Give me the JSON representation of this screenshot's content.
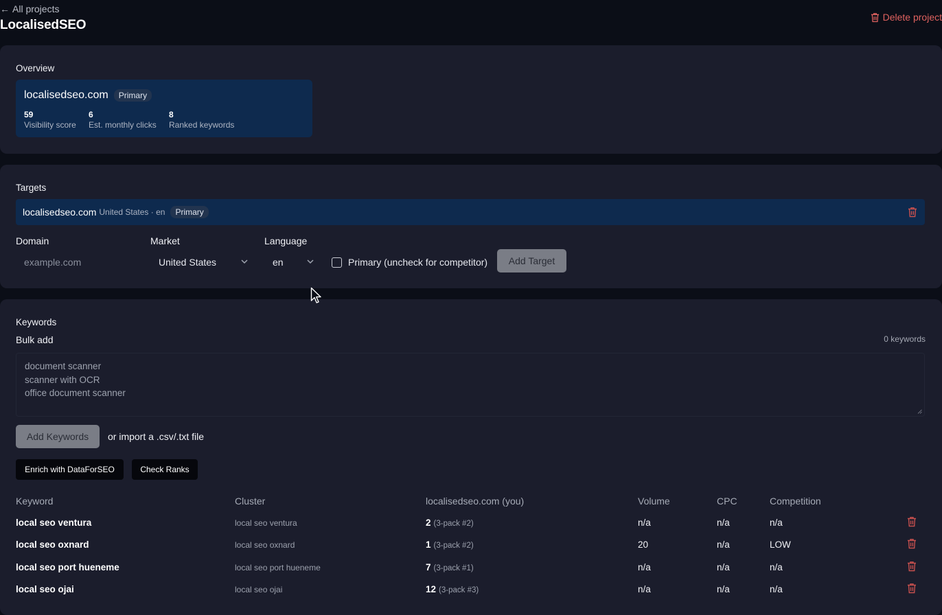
{
  "header": {
    "back_label": "All projects",
    "project_name": "LocalisedSEO",
    "delete_label": "Delete project"
  },
  "overview": {
    "heading": "Overview",
    "domain": "localisedseo.com",
    "badge": "Primary",
    "stats": [
      {
        "value": "59",
        "label": "Visibility score"
      },
      {
        "value": "6",
        "label": "Est. monthly clicks"
      },
      {
        "value": "8",
        "label": "Ranked keywords"
      }
    ]
  },
  "targets": {
    "heading": "Targets",
    "row": {
      "domain": "localisedseo.com",
      "meta": "United States · en",
      "badge": "Primary"
    },
    "form": {
      "domain_label": "Domain",
      "domain_placeholder": "example.com",
      "market_label": "Market",
      "market_value": "United States",
      "language_label": "Language",
      "language_value": "en",
      "primary_label": "Primary (uncheck for competitor)",
      "add_button": "Add Target"
    }
  },
  "keywords": {
    "heading": "Keywords",
    "bulk_label": "Bulk add",
    "count": "0 keywords",
    "placeholder_lines": [
      "document scanner",
      "scanner with OCR",
      "office document scanner"
    ],
    "add_button": "Add Keywords",
    "import_text": "or import a .csv/.txt file",
    "enrich_button": "Enrich with DataForSEO",
    "check_button": "Check Ranks",
    "columns": [
      "Keyword",
      "Cluster",
      "localisedseo.com (you)",
      "Volume",
      "CPC",
      "Competition"
    ],
    "rows": [
      {
        "keyword": "local seo ventura",
        "cluster": "local seo ventura",
        "rank": "2",
        "pack": "(3-pack #2)",
        "volume": "n/a",
        "cpc": "n/a",
        "competition": "n/a"
      },
      {
        "keyword": "local seo oxnard",
        "cluster": "local seo oxnard",
        "rank": "1",
        "pack": "(3-pack #2)",
        "volume": "20",
        "cpc": "n/a",
        "competition": "LOW"
      },
      {
        "keyword": "local seo port hueneme",
        "cluster": "local seo port hueneme",
        "rank": "7",
        "pack": "(3-pack #1)",
        "volume": "n/a",
        "cpc": "n/a",
        "competition": "n/a"
      },
      {
        "keyword": "local seo ojai",
        "cluster": "local seo ojai",
        "rank": "12",
        "pack": "(3-pack #3)",
        "volume": "n/a",
        "cpc": "n/a",
        "competition": "n/a"
      }
    ]
  },
  "colors": {
    "background": "#0b0e17",
    "card": "#1b1d2c",
    "highlight": "#0e2a4e",
    "danger": "#e0625f"
  }
}
